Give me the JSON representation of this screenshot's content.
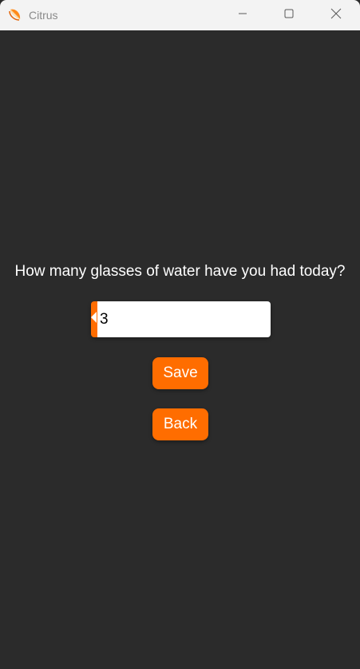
{
  "window": {
    "title": "Citrus",
    "controls": {
      "minimize_icon": "minimize-icon",
      "maximize_icon": "maximize-icon",
      "close_icon": "close-icon"
    }
  },
  "main": {
    "question": "How many glasses of water have you had today?",
    "stepper": {
      "value": "3",
      "decrement_icon": "triangle-left-icon",
      "increment_icon": "triangle-right-icon"
    },
    "save_label": "Save",
    "back_label": "Back"
  },
  "colors": {
    "accent": "#ff6d00",
    "background": "#2b2b2b",
    "titlebar": "#f3f3f3",
    "text": "#ffffff"
  }
}
